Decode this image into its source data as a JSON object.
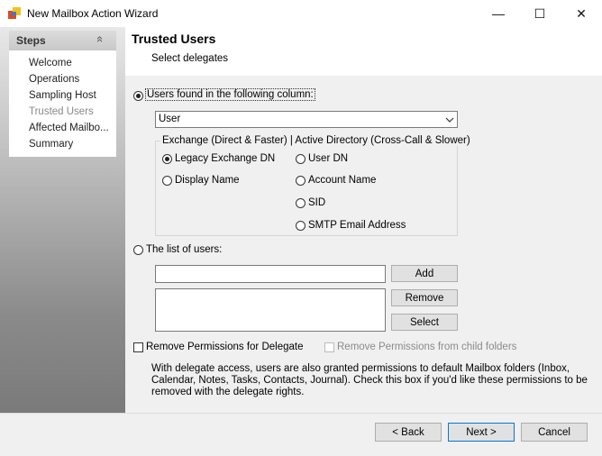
{
  "window": {
    "title": "New Mailbox Action Wizard",
    "minimize_glyph": "—",
    "maximize_glyph": "☐",
    "close_glyph": "✕"
  },
  "steps": {
    "title": "Steps",
    "collapse_glyph": "«",
    "items": [
      {
        "label": "Welcome"
      },
      {
        "label": "Operations"
      },
      {
        "label": "Sampling Host"
      },
      {
        "label": "Trusted Users"
      },
      {
        "label": "Affected Mailbo..."
      },
      {
        "label": "Summary"
      }
    ],
    "active_index": 3
  },
  "page": {
    "title": "Trusted Users",
    "subtitle": "Select delegates"
  },
  "source": {
    "column_option_label": "Users found in the following column:",
    "column_option_selected": true,
    "column_value": "User",
    "group_title": "Exchange (Direct & Faster) | Active Directory (Cross-Call & Slower)",
    "exchange_options": [
      {
        "label": "Legacy Exchange DN",
        "selected": true
      },
      {
        "label": "Display Name",
        "selected": false
      }
    ],
    "ad_options": [
      {
        "label": "User DN",
        "selected": false
      },
      {
        "label": "Account Name",
        "selected": false
      },
      {
        "label": "SID",
        "selected": false
      },
      {
        "label": "SMTP Email Address",
        "selected": false
      }
    ],
    "list_option_label": "The list of users:",
    "list_option_selected": false,
    "list_input_value": ""
  },
  "buttons": {
    "add": "Add",
    "remove": "Remove",
    "select": "Select",
    "back": "< Back",
    "next": "Next >",
    "cancel": "Cancel"
  },
  "permissions": {
    "remove_for_delegate_label": "Remove Permissions for Delegate",
    "remove_for_delegate_checked": false,
    "remove_child_label": "Remove Permissions from child folders",
    "remove_child_enabled": false,
    "description": "With delegate access, users are also granted permissions to default Mailbox folders (Inbox, Calendar, Notes, Tasks, Contacts, Journal).  Check this box if you'd like these permissions to be removed with the delegate rights."
  }
}
